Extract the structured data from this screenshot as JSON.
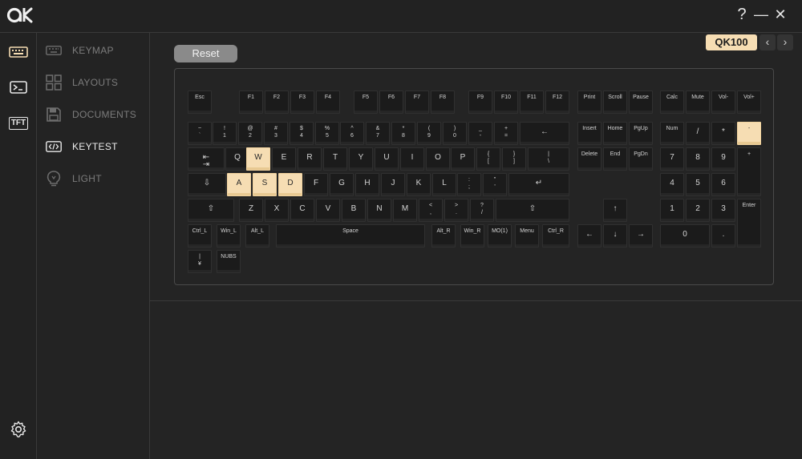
{
  "app": {
    "logo_text": "ak"
  },
  "window_controls": {
    "help": "?",
    "minimize": "—",
    "close": "✕"
  },
  "rail": {
    "items": [
      {
        "id": "keyboard",
        "icon": "keyboard-icon",
        "active": true
      },
      {
        "id": "terminal",
        "icon": "terminal-icon",
        "active": false
      },
      {
        "id": "tft",
        "icon": "tft-icon",
        "label": "TFT",
        "active": false
      }
    ],
    "settings_icon": "gear-icon"
  },
  "menu": {
    "items": [
      {
        "label": "KEYMAP",
        "icon": "keyboard-icon",
        "active": false
      },
      {
        "label": "LAYOUTS",
        "icon": "grid-icon",
        "active": false
      },
      {
        "label": "DOCUMENTS",
        "icon": "save-icon",
        "active": false
      },
      {
        "label": "KEYTEST",
        "icon": "code-icon",
        "active": true
      },
      {
        "label": "LIGHT",
        "icon": "bulb-icon",
        "active": false
      }
    ]
  },
  "toolbar": {
    "reset_label": "Reset"
  },
  "device": {
    "model": "QK100",
    "prev": "‹",
    "next": "›"
  },
  "colors": {
    "accent": "#f6ddb3",
    "bg": "#242424",
    "key": "#1b1b1b"
  },
  "keyboard": {
    "pressed": [
      "W",
      "A",
      "S",
      "D",
      "-"
    ],
    "keys": [
      {
        "l": "Esc",
        "c": "esc"
      },
      {
        "l": "F1",
        "c": "f1"
      },
      {
        "l": "F2",
        "c": "f2"
      },
      {
        "l": "F3",
        "c": "f3"
      },
      {
        "l": "F4",
        "c": "f4"
      },
      {
        "l": "F5",
        "c": "f5"
      },
      {
        "l": "F6",
        "c": "f6"
      },
      {
        "l": "F7",
        "c": "f7"
      },
      {
        "l": "F8",
        "c": "f8"
      },
      {
        "l": "F9",
        "c": "f9"
      },
      {
        "l": "F10",
        "c": "f10"
      },
      {
        "l": "F11",
        "c": "f11"
      },
      {
        "l": "F12",
        "c": "f12"
      },
      {
        "l": "Print",
        "c": "print"
      },
      {
        "l": "Scroll",
        "c": "scroll"
      },
      {
        "l": "Pause",
        "c": "pause"
      },
      {
        "l": "Calc",
        "c": "calc"
      },
      {
        "l": "Mute",
        "c": "mute"
      },
      {
        "l": "Vol-",
        "c": "vol-down"
      },
      {
        "l": "Vol+",
        "c": "vol-up"
      },
      {
        "l": "~\n`",
        "c": "grave"
      },
      {
        "l": "!\n1",
        "c": "1"
      },
      {
        "l": "@\n2",
        "c": "2"
      },
      {
        "l": "#\n3",
        "c": "3"
      },
      {
        "l": "$\n4",
        "c": "4"
      },
      {
        "l": "%\n5",
        "c": "5"
      },
      {
        "l": "^\n6",
        "c": "6"
      },
      {
        "l": "&\n7",
        "c": "7"
      },
      {
        "l": "*\n8",
        "c": "8"
      },
      {
        "l": "(\n9",
        "c": "9"
      },
      {
        "l": ")\n0",
        "c": "0"
      },
      {
        "l": "_\n-",
        "c": "minus"
      },
      {
        "l": "+\n=",
        "c": "equal"
      },
      {
        "l": "←",
        "c": "backspace"
      },
      {
        "l": "Insert",
        "c": "insert"
      },
      {
        "l": "Home",
        "c": "home"
      },
      {
        "l": "PgUp",
        "c": "pgup"
      },
      {
        "l": "Num",
        "c": "numlock"
      },
      {
        "l": "/",
        "c": "np-slash"
      },
      {
        "l": "*",
        "c": "np-star"
      },
      {
        "l": "-",
        "c": "np-minus"
      },
      {
        "l": "⇤\n⇥",
        "c": "tab"
      },
      {
        "l": "Q",
        "c": "q"
      },
      {
        "l": "W",
        "c": "w"
      },
      {
        "l": "E",
        "c": "e"
      },
      {
        "l": "R",
        "c": "r"
      },
      {
        "l": "T",
        "c": "t"
      },
      {
        "l": "Y",
        "c": "y"
      },
      {
        "l": "U",
        "c": "u"
      },
      {
        "l": "I",
        "c": "i"
      },
      {
        "l": "O",
        "c": "o"
      },
      {
        "l": "P",
        "c": "p"
      },
      {
        "l": "{\n[",
        "c": "lbracket"
      },
      {
        "l": "}\n]",
        "c": "rbracket"
      },
      {
        "l": "|\n\\",
        "c": "backslash"
      },
      {
        "l": "Delete",
        "c": "delete"
      },
      {
        "l": "End",
        "c": "end"
      },
      {
        "l": "PgDn",
        "c": "pgdn"
      },
      {
        "l": "7",
        "c": "np-7"
      },
      {
        "l": "8",
        "c": "np-8"
      },
      {
        "l": "9",
        "c": "np-9"
      },
      {
        "l": "+",
        "c": "np-plus"
      },
      {
        "l": "⇩",
        "c": "caps"
      },
      {
        "l": "A",
        "c": "a"
      },
      {
        "l": "S",
        "c": "s"
      },
      {
        "l": "D",
        "c": "d"
      },
      {
        "l": "F",
        "c": "f"
      },
      {
        "l": "G",
        "c": "g"
      },
      {
        "l": "H",
        "c": "h"
      },
      {
        "l": "J",
        "c": "j"
      },
      {
        "l": "K",
        "c": "k"
      },
      {
        "l": "L",
        "c": "l"
      },
      {
        "l": ":\n;",
        "c": "semicolon"
      },
      {
        "l": "\"\n'",
        "c": "quote"
      },
      {
        "l": "↵",
        "c": "enter"
      },
      {
        "l": "4",
        "c": "np-4"
      },
      {
        "l": "5",
        "c": "np-5"
      },
      {
        "l": "6",
        "c": "np-6"
      },
      {
        "l": "⇧",
        "c": "lshift"
      },
      {
        "l": "Z",
        "c": "z"
      },
      {
        "l": "X",
        "c": "x"
      },
      {
        "l": "C",
        "c": "c"
      },
      {
        "l": "V",
        "c": "v"
      },
      {
        "l": "B",
        "c": "b"
      },
      {
        "l": "N",
        "c": "n"
      },
      {
        "l": "M",
        "c": "m"
      },
      {
        "l": "<\n,",
        "c": "comma"
      },
      {
        "l": ">\n.",
        "c": "period"
      },
      {
        "l": "?\n/",
        "c": "slash"
      },
      {
        "l": "⇧",
        "c": "rshift"
      },
      {
        "l": "↑",
        "c": "up"
      },
      {
        "l": "1",
        "c": "np-1"
      },
      {
        "l": "2",
        "c": "np-2"
      },
      {
        "l": "3",
        "c": "np-3"
      },
      {
        "l": "Enter",
        "c": "np-enter"
      },
      {
        "l": "Ctrl_L",
        "c": "lctrl"
      },
      {
        "l": "Win_L",
        "c": "lwin"
      },
      {
        "l": "Alt_L",
        "c": "lalt"
      },
      {
        "l": "Space",
        "c": "space"
      },
      {
        "l": "Alt_R",
        "c": "ralt"
      },
      {
        "l": "Win_R",
        "c": "rwin"
      },
      {
        "l": "MO(1)",
        "c": "fn"
      },
      {
        "l": "Menu",
        "c": "menu"
      },
      {
        "l": "Ctrl_R",
        "c": "rctrl"
      },
      {
        "l": "←",
        "c": "left"
      },
      {
        "l": "↓",
        "c": "down"
      },
      {
        "l": "→",
        "c": "right"
      },
      {
        "l": "0",
        "c": "np-0"
      },
      {
        "l": ".",
        "c": "np-dot"
      },
      {
        "l": "|\n¥",
        "c": "yen"
      },
      {
        "l": "NUBS",
        "c": "nubs"
      }
    ]
  }
}
